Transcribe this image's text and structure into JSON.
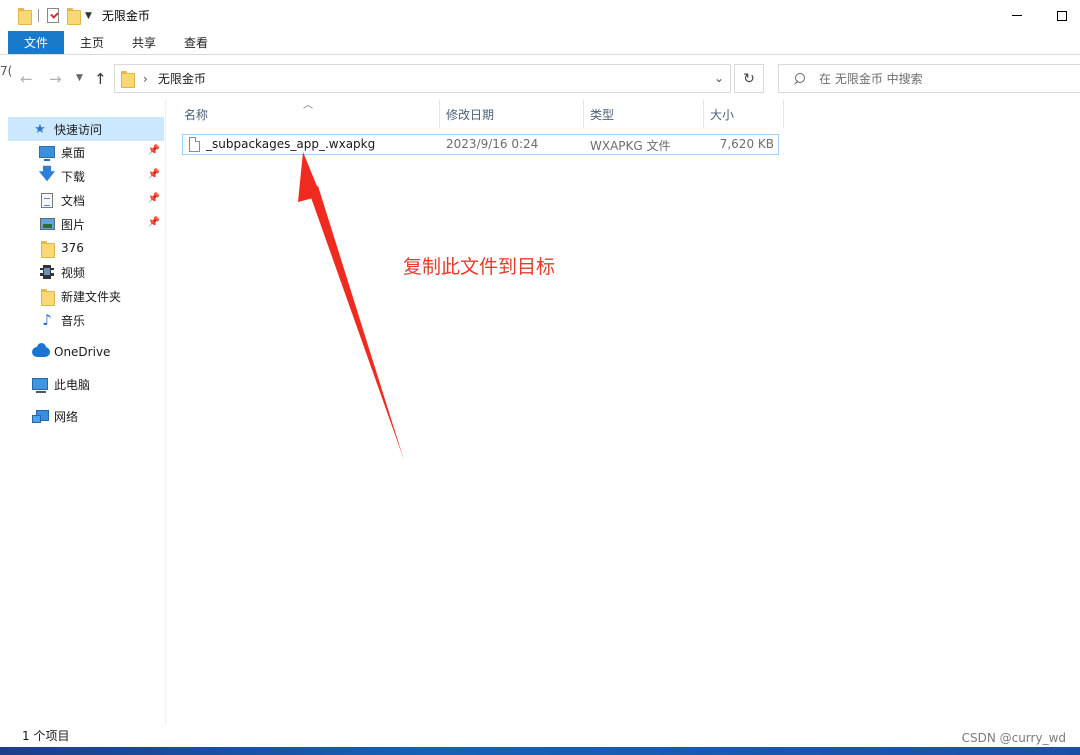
{
  "window": {
    "title": "无限金币",
    "minimize_label": "—",
    "maximize_label": ""
  },
  "ribbon": {
    "tabs": [
      {
        "label": "文件",
        "active": true
      },
      {
        "label": "主页"
      },
      {
        "label": "共享"
      },
      {
        "label": "查看"
      }
    ]
  },
  "address": {
    "path": "无限金币",
    "search_placeholder": "在 无限金币 中搜索",
    "left_clip": "7("
  },
  "nav": {
    "quick_access": "快速访问",
    "items": [
      {
        "label": "桌面",
        "pinned": true
      },
      {
        "label": "下载",
        "pinned": true
      },
      {
        "label": "文档",
        "pinned": true
      },
      {
        "label": "图片",
        "pinned": true
      },
      {
        "label": "376"
      },
      {
        "label": "视频"
      },
      {
        "label": "新建文件夹"
      },
      {
        "label": "音乐"
      }
    ],
    "onedrive": "OneDrive",
    "this_pc": "此电脑",
    "network": "网络"
  },
  "columns": {
    "name": "名称",
    "modified": "修改日期",
    "type": "类型",
    "size": "大小"
  },
  "files": [
    {
      "name": "_subpackages_app_.wxapkg",
      "modified": "2023/9/16 0:24",
      "type": "WXAPKG 文件",
      "size": "7,620 KB"
    }
  ],
  "annotation": {
    "text": "复制此文件到目标",
    "color": "#e83a2c"
  },
  "status": {
    "count": "1 个项目"
  },
  "watermark": "CSDN @curry_wd",
  "colors": {
    "accent": "#1979ca",
    "selection": "#cce8ff",
    "row_border": "#99d1ff"
  }
}
